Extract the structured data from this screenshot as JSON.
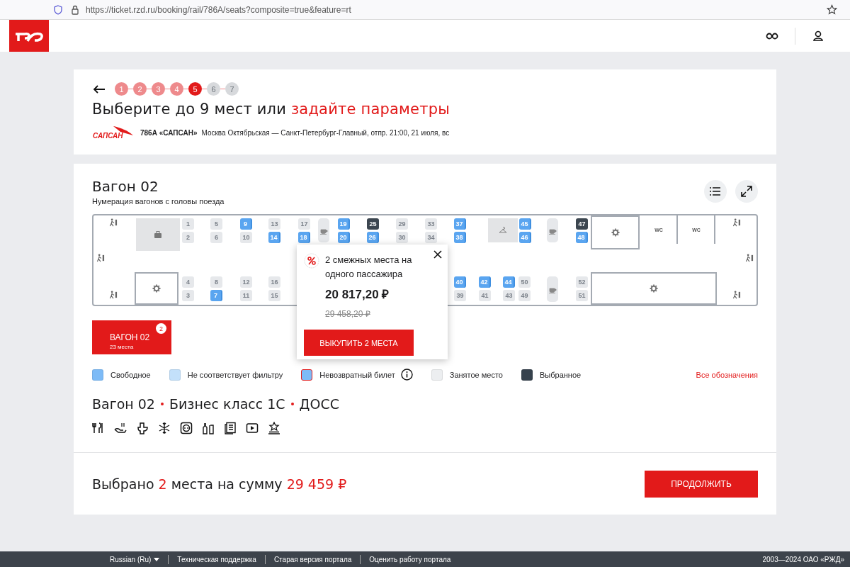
{
  "browser": {
    "url": "https://ticket.rzd.ru/booking/rail/786A/seats?composite=true&feature=rt"
  },
  "steps": [
    {
      "label": "1",
      "completed": true,
      "selected": false
    },
    {
      "label": "2",
      "completed": true,
      "selected": false
    },
    {
      "label": "3",
      "completed": true,
      "selected": false
    },
    {
      "label": "4",
      "completed": true,
      "selected": false
    },
    {
      "label": "5",
      "completed": false,
      "selected": true
    },
    {
      "label": "6",
      "completed": false,
      "selected": false
    },
    {
      "label": "7",
      "completed": false,
      "selected": false
    }
  ],
  "title": {
    "text": "Выберите до 9 мест или",
    "link": "задайте параметры"
  },
  "train": {
    "logo_text": "САПСАН",
    "name": "786А «САПСАН»",
    "route": "Москва Октябрьская — Санкт-Петербург-Главный,  отпр. 21:00, 21 июля, вс"
  },
  "wagon": {
    "title": "Вагон 02",
    "subtitle": "Нумерация вагонов с головы поезда"
  },
  "seat_map": {
    "top_columns": [
      [
        {
          "number": "1",
          "occupied": true,
          "selected": false
        },
        {
          "number": "2",
          "occupied": true,
          "selected": false
        }
      ],
      [
        {
          "number": "5",
          "occupied": true,
          "selected": false
        },
        {
          "number": "6",
          "occupied": true,
          "selected": false
        }
      ],
      [
        {
          "number": "9",
          "occupied": false,
          "selected": false
        },
        {
          "number": "10",
          "occupied": true,
          "selected": false
        }
      ],
      [
        {
          "number": "13",
          "occupied": true,
          "selected": false
        },
        {
          "number": "14",
          "occupied": false,
          "selected": false
        }
      ],
      [
        {
          "number": "17",
          "occupied": true,
          "selected": false
        },
        {
          "number": "18",
          "occupied": false,
          "selected": false
        }
      ],
      [
        {
          "number": "19",
          "occupied": false,
          "selected": false
        },
        {
          "number": "20",
          "occupied": false,
          "selected": false
        }
      ],
      [
        {
          "number": "25",
          "occupied": false,
          "selected": true
        },
        {
          "number": "26",
          "occupied": false,
          "selected": false
        }
      ],
      [
        {
          "number": "29",
          "occupied": true,
          "selected": false
        },
        {
          "number": "30",
          "occupied": true,
          "selected": false
        }
      ],
      [
        {
          "number": "33",
          "occupied": true,
          "selected": false
        },
        {
          "number": "34",
          "occupied": true,
          "selected": false
        }
      ],
      [
        {
          "number": "37",
          "occupied": false,
          "selected": false
        },
        {
          "number": "38",
          "occupied": false,
          "selected": false
        }
      ],
      [
        {
          "number": "45",
          "occupied": false,
          "selected": false
        },
        {
          "number": "46",
          "occupied": false,
          "selected": false
        }
      ],
      [
        {
          "number": "47",
          "occupied": false,
          "selected": true
        },
        {
          "number": "48",
          "occupied": false,
          "selected": false
        }
      ]
    ],
    "bottom_columns": [
      [
        {
          "number": "4",
          "occupied": true,
          "selected": false
        },
        {
          "number": "3",
          "occupied": true,
          "selected": false
        }
      ],
      [
        {
          "number": "8",
          "occupied": true,
          "selected": false
        },
        {
          "number": "7",
          "occupied": false,
          "selected": false
        }
      ],
      [
        {
          "number": "12",
          "occupied": true,
          "selected": false
        },
        {
          "number": "11",
          "occupied": true,
          "selected": false
        }
      ],
      [
        {
          "number": "16",
          "occupied": true,
          "selected": false
        },
        {
          "number": "15",
          "occupied": true,
          "selected": false
        }
      ],
      [
        {
          "number": "40",
          "occupied": false,
          "selected": false
        },
        {
          "number": "39",
          "occupied": true,
          "selected": false
        }
      ],
      [
        {
          "number": "42",
          "occupied": false,
          "selected": false
        },
        {
          "number": "41",
          "occupied": true,
          "selected": false
        }
      ],
      [
        {
          "number": "44",
          "occupied": false,
          "selected": false
        },
        {
          "number": "43",
          "occupied": true,
          "selected": false
        }
      ],
      [
        {
          "number": "50",
          "occupied": true,
          "selected": false
        },
        {
          "number": "49",
          "occupied": true,
          "selected": false
        }
      ],
      [
        {
          "number": "52",
          "occupied": true,
          "selected": false
        },
        {
          "number": "51",
          "occupied": true,
          "selected": false
        }
      ]
    ],
    "fixtures": [
      {
        "kind": "exit"
      },
      {
        "kind": "exit"
      },
      {
        "kind": "exit"
      },
      {
        "kind": "exit"
      },
      {
        "kind": "exit"
      },
      {
        "kind": "exit"
      },
      {
        "kind": "luggage"
      },
      {
        "kind": "coffee"
      },
      {
        "kind": "coffee"
      },
      {
        "kind": "coffee"
      },
      {
        "kind": "hanger"
      },
      {
        "kind": "service"
      },
      {
        "kind": "service"
      },
      {
        "kind": "service"
      },
      {
        "kind": "wc",
        "label": "WC"
      },
      {
        "kind": "wc",
        "label": "WC"
      }
    ]
  },
  "popup": {
    "text": "2 смежных места на одного пассажира",
    "price": "20 817,20 ₽",
    "old_price": "29 458,20 ₽",
    "button": "ВЫКУПИТЬ 2 МЕСТА"
  },
  "wagon_tabs": [
    {
      "label": "ВАГОН 02",
      "seats": "23 места",
      "badge": "2",
      "selected": true
    }
  ],
  "legend": [
    {
      "label": "Свободное",
      "color": "#7dbbf7",
      "kind": "plain"
    },
    {
      "label": "Не соответствует фильтру",
      "color": "#c3e0fa",
      "kind": "plain"
    },
    {
      "label": "Невозвратный билет",
      "color": "#7dbbf7",
      "kind": "nonrefundable"
    },
    {
      "label": "Занятое место",
      "color": "#eceef0",
      "kind": "plain"
    },
    {
      "label": "Выбранное",
      "color": "#36424d",
      "kind": "plain"
    }
  ],
  "legend_link": "Все обозначения",
  "class_line": [
    "Вагон 02",
    "Бизнес класс 1С",
    "ДОСС"
  ],
  "total": {
    "prefix": "Выбрано",
    "count": "2",
    "middle": "места на сумму",
    "amount": "29 459 ₽"
  },
  "continue_button": "ПРОДОЛЖИТЬ",
  "footer": {
    "language": "Russian  (Ru)",
    "links": [
      "Техническая поддержка",
      "Старая версия портала",
      "Оценить работу портала"
    ],
    "copyright": "2003—2024 ОАО «РЖД»"
  }
}
